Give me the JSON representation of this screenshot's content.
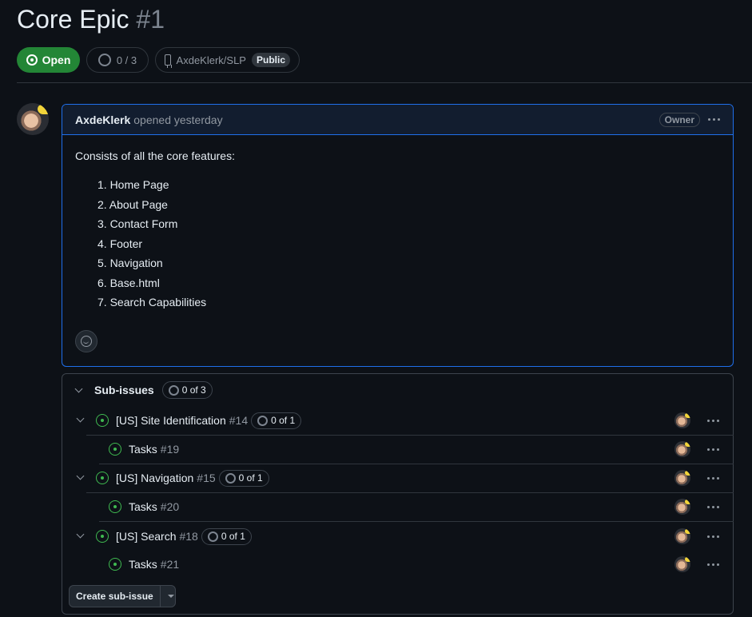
{
  "issue": {
    "title": "Core Epic",
    "number": "#1",
    "state": "Open",
    "progress": "0 / 3",
    "repo": "AxdeKlerk/SLP",
    "visibility": "Public"
  },
  "comment": {
    "author": "AxdeKlerk",
    "opened": "opened yesterday",
    "role": "Owner",
    "intro": "Consists of all the core features:",
    "features": [
      "1. Home Page",
      "2. About Page",
      "3. Contact Form",
      "4. Footer",
      "5. Navigation",
      "6. Base.html",
      "7. Search Capabilities"
    ]
  },
  "sub_issues": {
    "title": "Sub-issues",
    "count": "0 of 3",
    "items": [
      {
        "title": "[US] Site Identification",
        "number": "#14",
        "count": "0 of 1"
      },
      {
        "title": "Tasks",
        "number": "#19"
      },
      {
        "title": "[US] Navigation",
        "number": "#15",
        "count": "0 of 1"
      },
      {
        "title": "Tasks",
        "number": "#20"
      },
      {
        "title": "[US] Search",
        "number": "#18",
        "count": "0 of 1"
      },
      {
        "title": "Tasks",
        "number": "#21"
      }
    ],
    "create_label": "Create sub-issue"
  },
  "colors": {
    "accent_open": "#238636",
    "open_icon": "#3fb950",
    "focus_border": "#1f6feb",
    "background": "#0d1117"
  },
  "icons": [
    "issue-opened-icon",
    "progress-ring-icon",
    "repo-icon",
    "kebab-icon",
    "chevron-down-icon",
    "smiley-icon",
    "triangle-down-icon"
  ]
}
